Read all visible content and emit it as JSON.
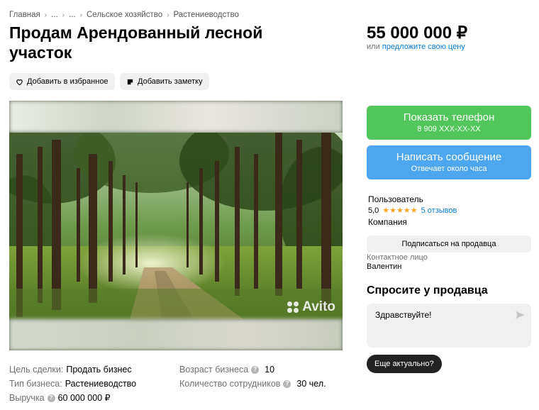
{
  "breadcrumb": [
    "Главная",
    "...",
    "...",
    "Сельское хозяйство",
    "Растениеводство"
  ],
  "title": "Продам Арендованный лесной участок",
  "actions": {
    "favorite": "Добавить в избранное",
    "note": "Добавить заметку"
  },
  "gallery": {
    "watermark": "Avito"
  },
  "params_left": [
    {
      "key": "Цель сделки:",
      "value": "Продать бизнес",
      "help": false
    },
    {
      "key": "Тип бизнеса:",
      "value": "Растениеводство",
      "help": false
    },
    {
      "key": "Выручка",
      "value": "60 000 000 ₽",
      "help": true
    }
  ],
  "params_right": [
    {
      "key": "Возраст бизнеса",
      "value": "10",
      "help": true
    },
    {
      "key": "Количество сотрудников",
      "value": "30 чел.",
      "help": true
    }
  ],
  "price": {
    "amount": "55 000 000 ₽",
    "or": "или",
    "offer_link": "предложите свою цену"
  },
  "phone_button": {
    "label": "Показать телефон",
    "sub": "8 909 XXX-XX-XX"
  },
  "message_button": {
    "label": "Написать сообщение",
    "sub": "Отвечает около часа"
  },
  "seller": {
    "type": "Пользователь",
    "rating": "5,0",
    "stars": "★★★★★",
    "reviews": "5 отзывов",
    "kind": "Компания",
    "subscribe": "Подписаться на продавца",
    "contact_label": "Контактное лицо",
    "contact_name": "Валентин"
  },
  "ask": {
    "title": "Спросите у продавца",
    "message": "Здравствуйте!",
    "quick_reply": "Еще актуально?"
  },
  "colors": {
    "green": "#53c65b",
    "blue": "#4da6ef",
    "link": "#0a7bd1",
    "star": "#f5a623"
  }
}
